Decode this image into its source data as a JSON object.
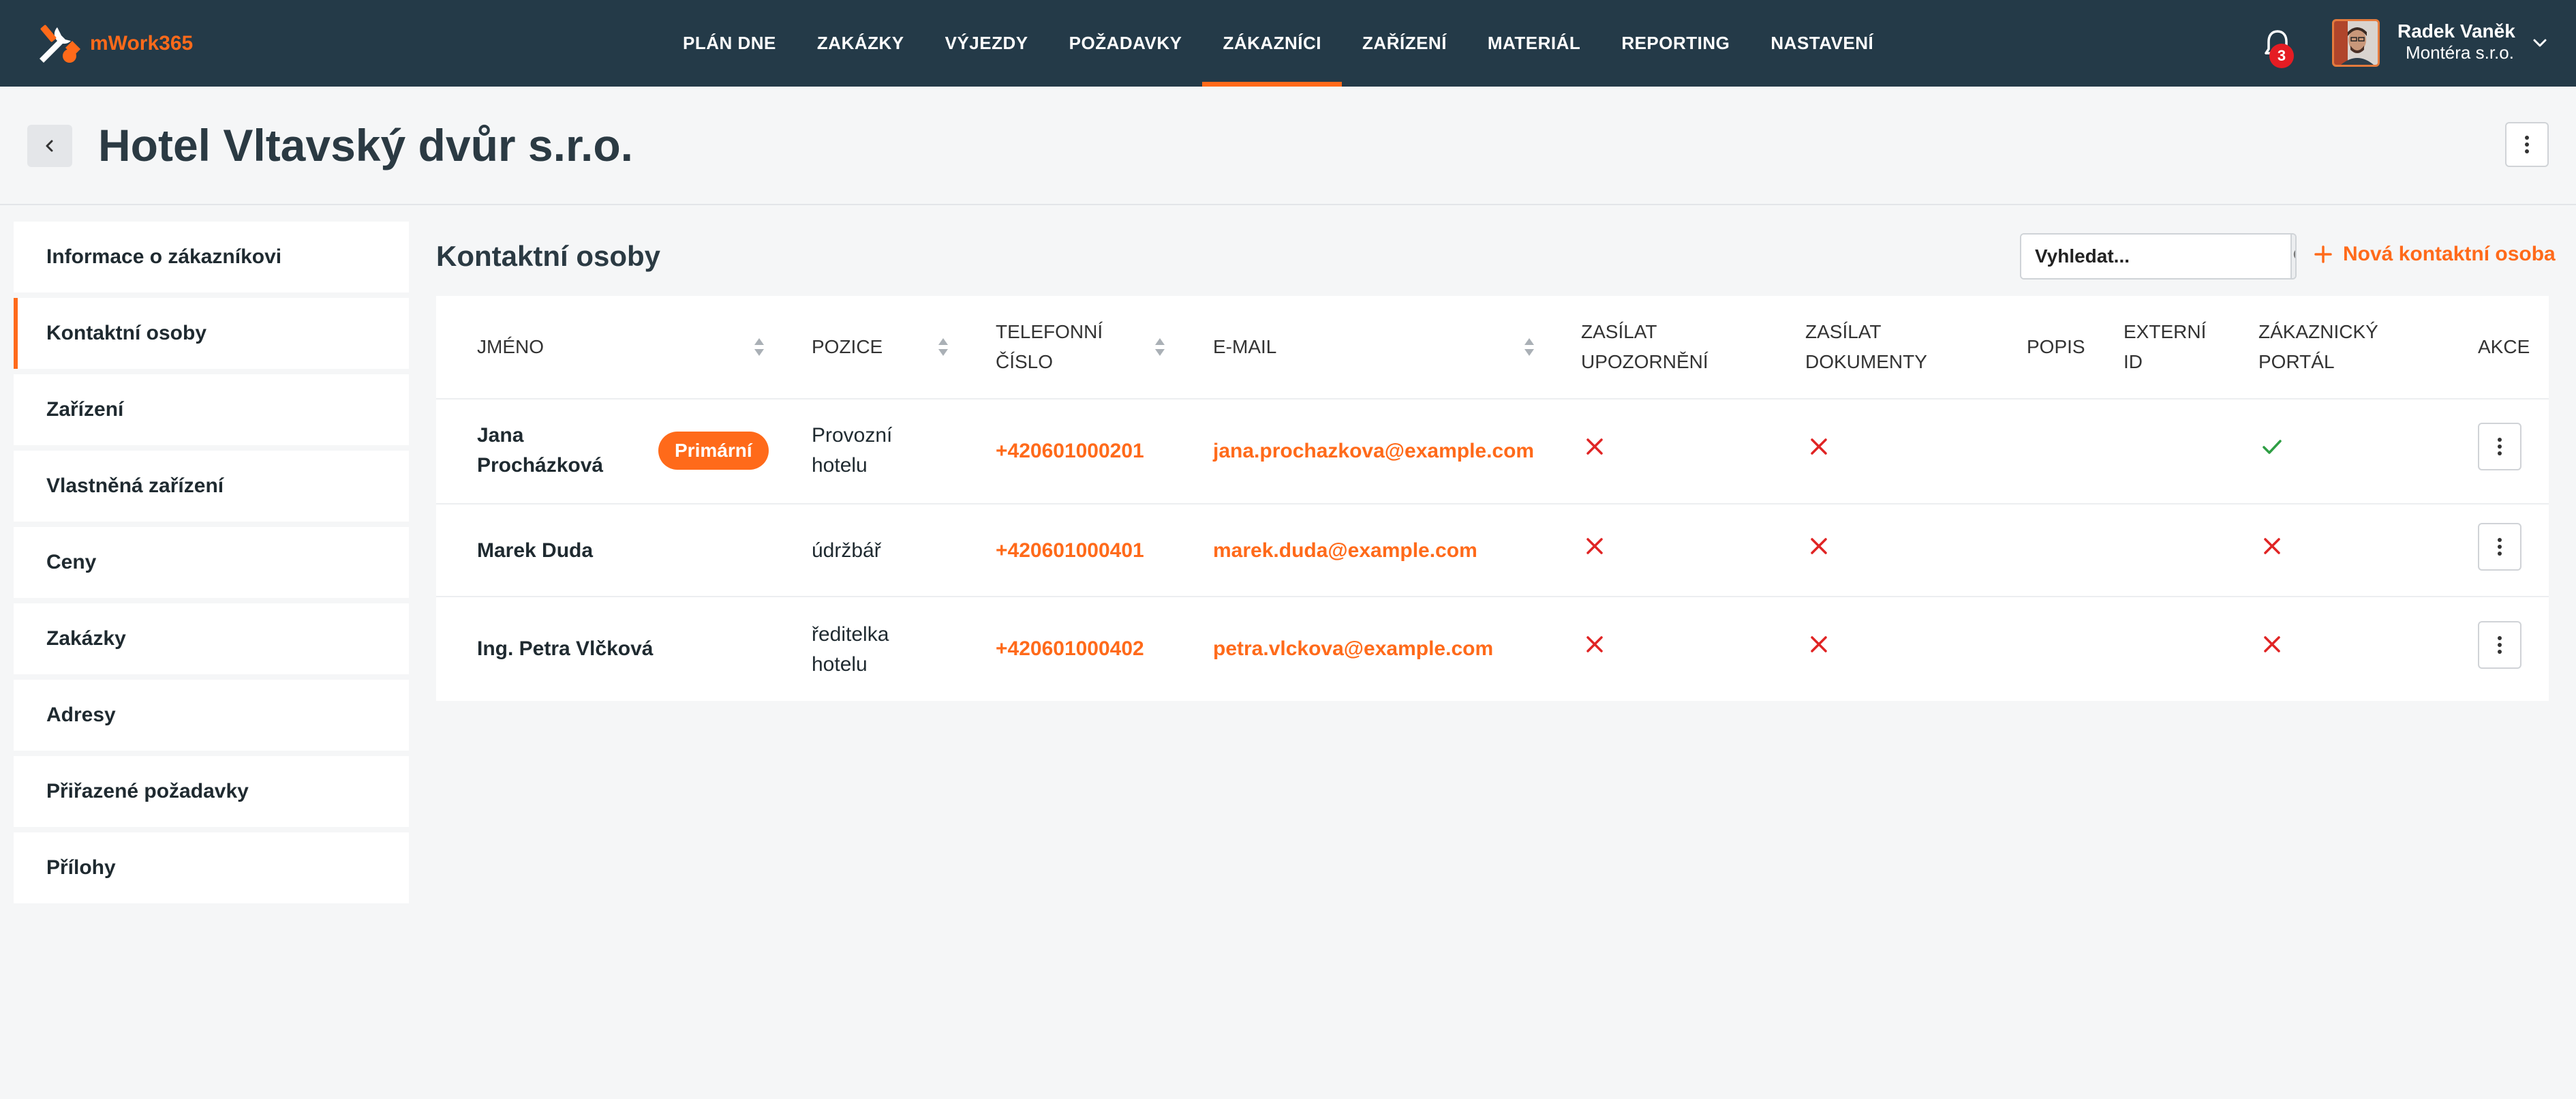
{
  "app": {
    "logo_text": "mWork365"
  },
  "nav": {
    "items": [
      {
        "label": "PLÁN DNE"
      },
      {
        "label": "ZAKÁZKY"
      },
      {
        "label": "VÝJEZDY"
      },
      {
        "label": "POŽADAVKY"
      },
      {
        "label": "ZÁKAZNÍCI",
        "active": true
      },
      {
        "label": "ZAŘÍZENÍ"
      },
      {
        "label": "MATERIÁL"
      },
      {
        "label": "REPORTING"
      },
      {
        "label": "NASTAVENÍ"
      }
    ]
  },
  "notifications": {
    "count": "3"
  },
  "user": {
    "name": "Radek Vaněk",
    "company": "Montéra s.r.o."
  },
  "page": {
    "title": "Hotel Vltavský dvůr s.r.o."
  },
  "sidebar": {
    "items": [
      {
        "label": "Informace o zákazníkovi"
      },
      {
        "label": "Kontaktní osoby",
        "active": true
      },
      {
        "label": "Zařízení"
      },
      {
        "label": "Vlastněná zařízení"
      },
      {
        "label": "Ceny"
      },
      {
        "label": "Zakázky"
      },
      {
        "label": "Adresy"
      },
      {
        "label": "Přiřazené požadavky"
      },
      {
        "label": "Přílohy"
      }
    ]
  },
  "section": {
    "title": "Kontaktní osoby",
    "search_placeholder": "Vyhledat...",
    "add_label": "Nová kontaktní osoba"
  },
  "table": {
    "columns": {
      "name": "JMÉNO",
      "position": "POZICE",
      "phone_1": "TELEFONNÍ",
      "phone_2": "ČÍSLO",
      "email": "E-MAIL",
      "notify_1": "ZASÍLAT",
      "notify_2": "UPOZORNĚNÍ",
      "docs_1": "ZASÍLAT",
      "docs_2": "DOKUMENTY",
      "desc": "POPIS",
      "ext_1": "EXTERNÍ",
      "ext_2": "ID",
      "portal_1": "ZÁKAZNICKÝ",
      "portal_2": "PORTÁL",
      "actions": "AKCE"
    },
    "rows": [
      {
        "name_1": "Jana",
        "name_2": "Procházková",
        "badge": "Primární",
        "position_1": "Provozní",
        "position_2": "hotelu",
        "phone": "+420601000201",
        "email": "jana.prochazkova@example.com",
        "notify": false,
        "docs": false,
        "portal": true
      },
      {
        "name_1": "Marek Duda",
        "position_1": "údržbář",
        "phone": "+420601000401",
        "email": "marek.duda@example.com",
        "notify": false,
        "docs": false,
        "portal": false
      },
      {
        "name_1": "Ing. Petra Vlčková",
        "position_1": "ředitelka",
        "position_2": "hotelu",
        "phone": "+420601000402",
        "email": "petra.vlckova@example.com",
        "notify": false,
        "docs": false,
        "portal": false
      }
    ]
  },
  "colors": {
    "accent": "#ff6a1a",
    "topbar": "#243a48",
    "no": "#e02424",
    "yes": "#2e9e44"
  }
}
